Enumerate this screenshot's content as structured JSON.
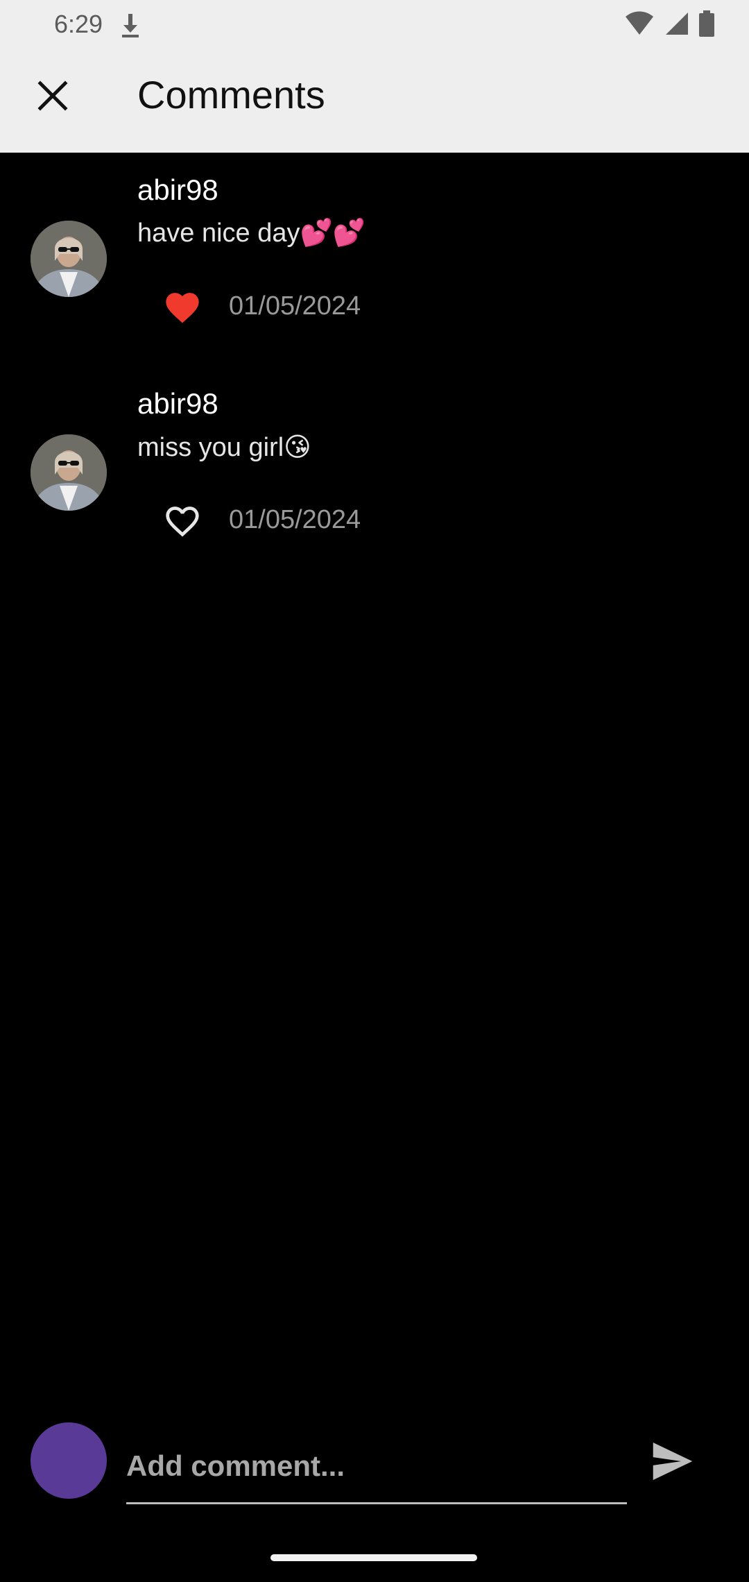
{
  "status_bar": {
    "time": "6:29"
  },
  "header": {
    "title": "Comments"
  },
  "comments": [
    {
      "username": "abir98",
      "text": "have nice day💕💕",
      "date": "01/05/2024",
      "liked": true
    },
    {
      "username": "abir98",
      "text": "miss you girl😘",
      "date": "01/05/2024",
      "liked": false
    }
  ],
  "composer": {
    "placeholder": "Add comment..."
  },
  "colors": {
    "app_bar": "#eeeeee",
    "background": "#000000",
    "like_active": "#f03a2e",
    "composer_avatar": "#5a3a97"
  }
}
